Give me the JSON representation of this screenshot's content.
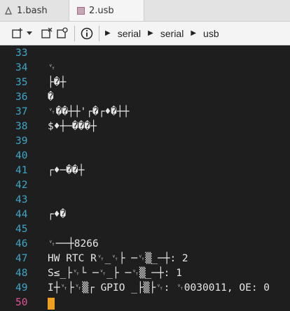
{
  "tabs": [
    {
      "label": "1.bash",
      "icon": "terminal-icon"
    },
    {
      "label": "2.usb",
      "icon": "serial-device-icon"
    }
  ],
  "toolbar": {
    "breadcrumb": [
      "serial",
      "serial",
      "usb"
    ]
  },
  "terminal": {
    "lines": [
      {
        "num": "33",
        "text": ""
      },
      {
        "num": "34",
        "text": "␋"
      },
      {
        "num": "35",
        "text": "├�┼"
      },
      {
        "num": "36",
        "text": "�"
      },
      {
        "num": "37",
        "text": "␋��┼┼'┌�┌♦�┼┼"
      },
      {
        "num": "38",
        "text": "$♦┼─���┼"
      },
      {
        "num": "39",
        "text": ""
      },
      {
        "num": "40",
        "text": ""
      },
      {
        "num": "41",
        "text": "┌♦─��┼"
      },
      {
        "num": "42",
        "text": ""
      },
      {
        "num": "43",
        "text": ""
      },
      {
        "num": "44",
        "text": "┌♦�"
      },
      {
        "num": "45",
        "text": ""
      },
      {
        "num": "46",
        "text": "␋──┼8266"
      },
      {
        "num": "47",
        "text": "HW RTC R␋_␋├ ─␋▒_─┼: 2"
      },
      {
        "num": "48",
        "text": "S≤_├␋└ ─␋_├ ─␋▒_─┼: 1"
      },
      {
        "num": "49",
        "text": "I┼␋├␋▒┌ GPIO _├▒├␋: ␋0030011, OE: 0"
      },
      {
        "num": "50",
        "text": ""
      }
    ]
  }
}
